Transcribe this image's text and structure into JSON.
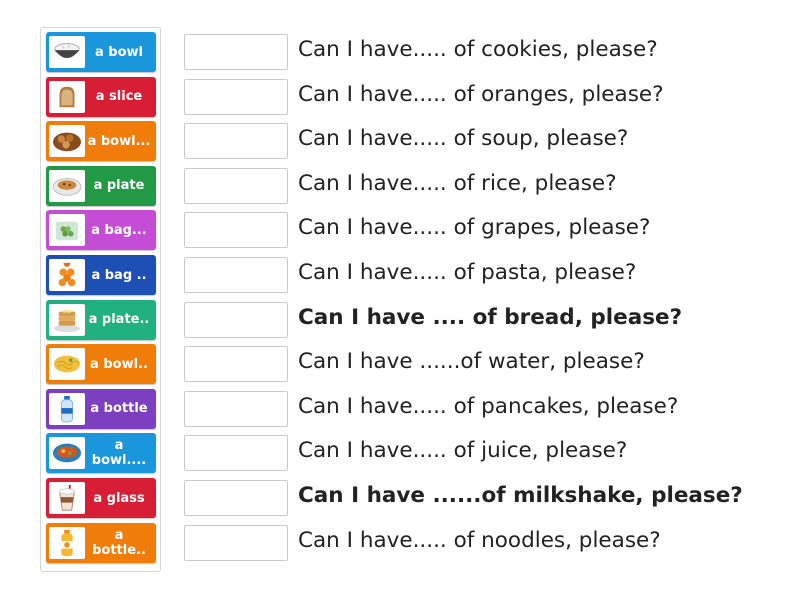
{
  "tiles": [
    {
      "label": "a bowl",
      "color": "#1a96dc",
      "icon": "rice-bowl-icon"
    },
    {
      "label": "a slice",
      "color": "#d81e34",
      "icon": "bread-slice-icon"
    },
    {
      "label": "a bowl...",
      "color": "#f07d0a",
      "icon": "cookies-bowl-icon"
    },
    {
      "label": "a plate",
      "color": "#219945",
      "icon": "cookies-plate-icon"
    },
    {
      "label": "a bag...",
      "color": "#c54dd6",
      "icon": "grapes-bag-icon"
    },
    {
      "label": "a bag ..",
      "color": "#1e4fb4",
      "icon": "oranges-bag-icon"
    },
    {
      "label": "a plate..",
      "color": "#21b07f",
      "icon": "pancakes-plate-icon"
    },
    {
      "label": "a bowl..",
      "color": "#f07d0a",
      "icon": "noodles-bowl-icon"
    },
    {
      "label": "a bottle",
      "color": "#7c3fbf",
      "icon": "water-bottle-icon"
    },
    {
      "label": "a bowl....",
      "color": "#1a96dc",
      "icon": "soup-bowl-icon"
    },
    {
      "label": "a glass",
      "color": "#d81e34",
      "icon": "milkshake-glass-icon"
    },
    {
      "label": "a bottle..",
      "color": "#f07d0a",
      "icon": "juice-bottle-icon"
    }
  ],
  "sentences": [
    {
      "text": "Can I have..... of cookies, please?",
      "bold": false
    },
    {
      "text": "Can I have..... of oranges, please?",
      "bold": false
    },
    {
      "text": "Can I have..... of soup, please?",
      "bold": false
    },
    {
      "text": "Can I have..... of rice, please?",
      "bold": false
    },
    {
      "text": "Can I have..... of grapes, please?",
      "bold": false
    },
    {
      "text": "Can I have..... of pasta, please?",
      "bold": false
    },
    {
      "text": "Can I have .... of bread, please?",
      "bold": true
    },
    {
      "text": "Can I have ......of water, please?",
      "bold": false
    },
    {
      "text": "Can I have..... of pancakes, please?",
      "bold": false
    },
    {
      "text": "Can I have..... of juice, please?",
      "bold": false
    },
    {
      "text": "Can I have ......of milkshake, please?",
      "bold": true
    },
    {
      "text": "Can I have..... of noodles, please?",
      "bold": false
    }
  ]
}
